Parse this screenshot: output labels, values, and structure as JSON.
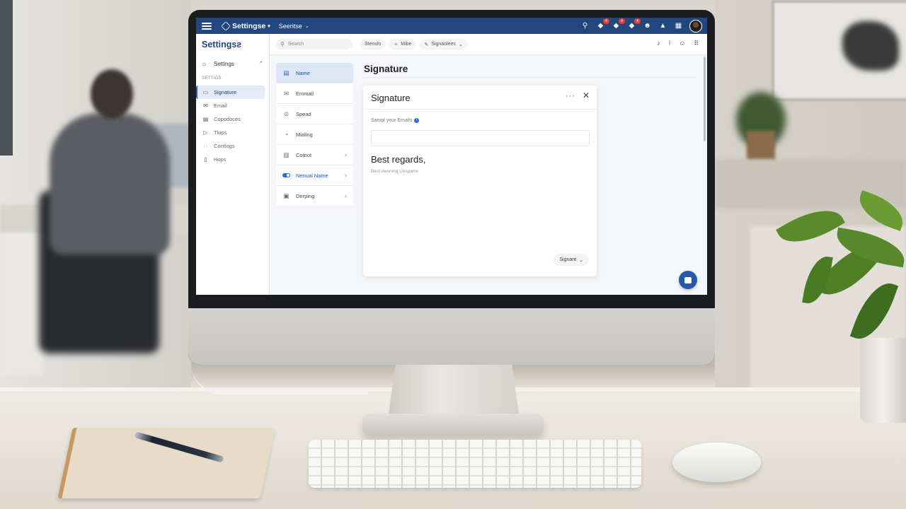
{
  "topbar": {
    "brand": "Settingse",
    "dropdown": "Seeritse",
    "icons": [
      "search-icon",
      "notification-icon",
      "message-icon",
      "alert-icon",
      "emoji-icon",
      "bell-icon",
      "grid-icon"
    ],
    "badges": [
      "4",
      "4",
      "4"
    ]
  },
  "leftnav": {
    "title": "Settingsƨ",
    "group_label": "Settings",
    "section_label": "SETTIGS",
    "items": [
      {
        "label": "Signature",
        "icon": "signature-icon",
        "active": true
      },
      {
        "label": "Email",
        "icon": "email-icon",
        "active": false
      },
      {
        "label": "Copodoces",
        "icon": "document-icon",
        "active": false
      },
      {
        "label": "Tlops",
        "icon": "play-icon",
        "active": false
      },
      {
        "label": "Contlogs",
        "icon": "circle-icon",
        "active": false
      },
      {
        "label": "Hops",
        "icon": "doc-icon",
        "active": false
      }
    ]
  },
  "searchrow": {
    "search_placeholder": "Search",
    "pills": [
      "Stenuls",
      "Mibe",
      "Signaolees"
    ]
  },
  "midmenu": {
    "items": [
      {
        "label": "Name",
        "icon": "id-card-icon",
        "active": true,
        "chevron": false
      },
      {
        "label": "Emmail",
        "icon": "mail-icon",
        "active": false,
        "chevron": false
      },
      {
        "label": "Spead",
        "icon": "speed-icon",
        "active": false,
        "chevron": false
      },
      {
        "label": "Mialing",
        "icon": "clock-icon",
        "active": false,
        "chevron": false
      },
      {
        "label": "Cotnot",
        "icon": "contact-icon",
        "active": false,
        "chevron": true
      },
      {
        "label": "Nenual Name",
        "icon": "toggle-icon",
        "active": false,
        "chevron": true
      },
      {
        "label": "Derping",
        "icon": "calendar-icon",
        "active": false,
        "chevron": true
      }
    ]
  },
  "main": {
    "page_title": "Signature",
    "card": {
      "title": "Signature",
      "field_label": "Sampl your Emails",
      "field_value": "",
      "signature_main": "Best regards,",
      "signature_sub": "Best Aenning Unsparre",
      "button_label": "Signant"
    }
  },
  "colors": {
    "topbar": "#22477f",
    "accent": "#2b5fb0",
    "active_bg": "#dce6f6",
    "badge": "#e0413b"
  }
}
